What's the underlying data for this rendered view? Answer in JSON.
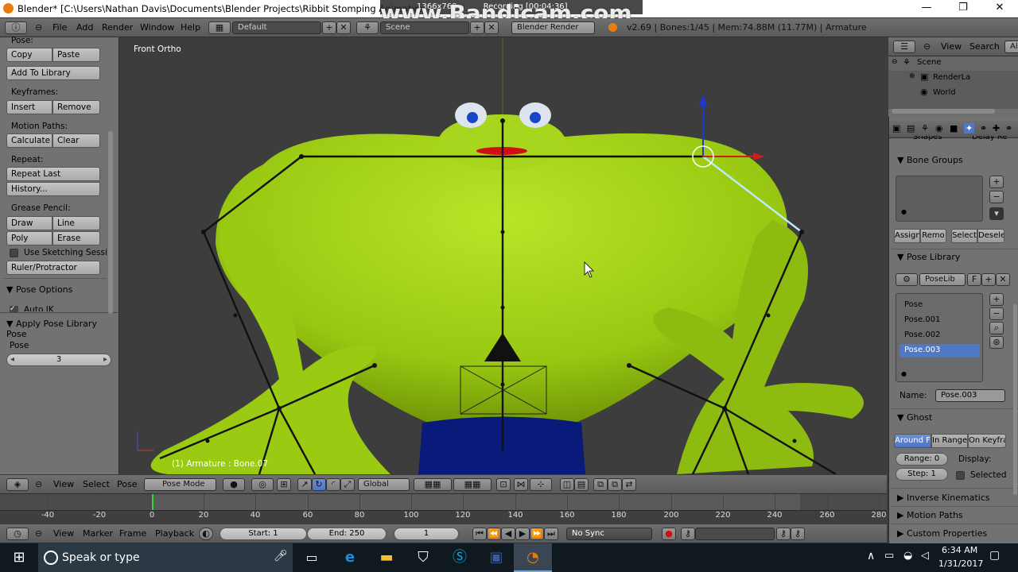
{
  "window": {
    "title": "Blender* [C:\\Users\\Nathan Davis\\Documents\\Blender Projects\\Ribbit Stomping Animation (",
    "minimize": "—",
    "maximize": "❐",
    "close": "✕"
  },
  "recorder": {
    "resolution": "1366x768",
    "recording": "Recording [00:04:36]",
    "watermark": "www.Bandicam.com"
  },
  "info_header": {
    "menus": [
      "File",
      "Add",
      "Render",
      "Window",
      "Help"
    ],
    "screen_layout": "Default",
    "scene": "Scene",
    "engine": "Blender Render",
    "stats": "v2.69 | Bones:1/45 | Mem:74.88M (11.77M) | Armature"
  },
  "toolshelf": {
    "pose_label": "Pose:",
    "copy": "Copy",
    "paste": "Paste",
    "add_to_library": "Add To Library",
    "keyframes_label": "Keyframes:",
    "insert": "Insert",
    "remove": "Remove",
    "motion_paths_label": "Motion Paths:",
    "calculate": "Calculate",
    "clear": "Clear",
    "repeat_label": "Repeat:",
    "repeat_last": "Repeat Last",
    "history": "History...",
    "grease_pencil_label": "Grease Pencil:",
    "draw": "Draw",
    "line": "Line",
    "poly": "Poly",
    "erase": "Erase",
    "use_sketching": "Use Sketching Sessi",
    "ruler": "Ruler/Protractor",
    "pose_options": "Pose Options",
    "auto_ik": "Auto IK",
    "apply_pose_library": "Apply Pose Library Pose",
    "pose_field_label": "Pose",
    "pose_value": "3"
  },
  "viewport": {
    "view_name": "Front Ortho",
    "status": "(1) Armature : Bone.07"
  },
  "viewport_header": {
    "view": "View",
    "select": "Select",
    "pose": "Pose",
    "mode": "Pose Mode",
    "orientation": "Global"
  },
  "timeline": {
    "ticks": [
      "-40",
      "-20",
      "0",
      "20",
      "40",
      "60",
      "80",
      "100",
      "120",
      "140",
      "160",
      "180",
      "200",
      "220",
      "240",
      "260",
      "280"
    ],
    "current_frame_marker": "0"
  },
  "timeline_header": {
    "view": "View",
    "marker": "Marker",
    "frame": "Frame",
    "playback": "Playback",
    "start": "Start: 1",
    "end": "End: 250",
    "current": "1",
    "sync": "No Sync"
  },
  "outliner": {
    "view": "View",
    "search": "Search",
    "all": "Al",
    "items": [
      "Scene",
      "RenderLa",
      "World"
    ]
  },
  "properties": {
    "shapes": "Shapes",
    "delay": "Delay Re",
    "bone_groups": "Bone Groups",
    "assign": "Assign",
    "remove": "Remo",
    "select": "Select",
    "deselect": "Desele",
    "pose_library": "Pose Library",
    "poselib_name": "PoseLib",
    "poselib_f": "F",
    "poses": [
      "Pose",
      "Pose.001",
      "Pose.002",
      "Pose.003"
    ],
    "selected_pose": "Pose.003",
    "name_label": "Name:",
    "name_value": "Pose.003",
    "ghost": "Ghost",
    "ghost_around": "Around F",
    "ghost_range": "In Range",
    "ghost_keyframes": "On Keyfra",
    "range_field": "Range: 0",
    "display_label": "Display:",
    "step_field": "Step: 1",
    "selected_label": "Selected",
    "inverse_kinematics": "Inverse Kinematics",
    "motion_paths": "Motion Paths",
    "custom_properties": "Custom Properties"
  },
  "taskbar": {
    "search": "Speak or type",
    "time": "6:34 AM",
    "date": "1/31/2017"
  },
  "colors": {
    "frog": "#9acb12",
    "pants": "#0a1a7a",
    "selection": "#5078c8"
  }
}
